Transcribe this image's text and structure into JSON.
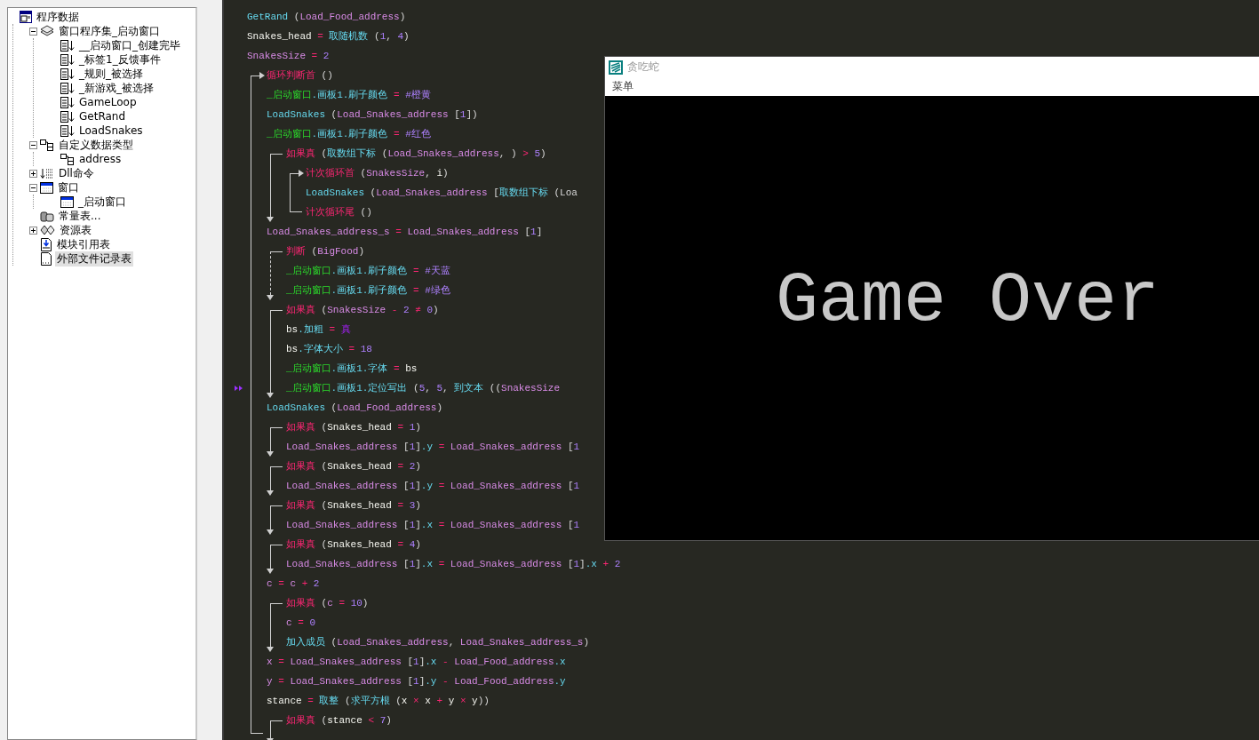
{
  "tree": [
    {
      "label": "程序数据",
      "kind": "root",
      "selected": false,
      "children": [
        {
          "label": "窗口程序集_启动窗口",
          "kind": "assembly",
          "selected": false,
          "expanded": true,
          "children": [
            {
              "label": "__启动窗口_创建完毕",
              "kind": "sub",
              "selected": false
            },
            {
              "label": "_标签1_反馈事件",
              "kind": "sub",
              "selected": false
            },
            {
              "label": "_规则_被选择",
              "kind": "sub",
              "selected": false
            },
            {
              "label": "_新游戏_被选择",
              "kind": "sub",
              "selected": false
            },
            {
              "label": "GameLoop",
              "kind": "sub",
              "selected": false
            },
            {
              "label": "GetRand",
              "kind": "sub",
              "selected": false
            },
            {
              "label": "LoadSnakes",
              "kind": "sub",
              "selected": false
            }
          ]
        },
        {
          "label": "自定义数据类型",
          "kind": "type",
          "selected": false,
          "expanded": true,
          "children": [
            {
              "label": "address",
              "kind": "type",
              "selected": false
            }
          ]
        },
        {
          "label": "Dll命令",
          "kind": "dll",
          "selected": false,
          "expanded": false
        },
        {
          "label": "窗口",
          "kind": "window",
          "selected": false,
          "expanded": true,
          "children": [
            {
              "label": "_启动窗口",
              "kind": "window",
              "selected": false
            }
          ]
        },
        {
          "label": "常量表...",
          "kind": "const",
          "selected": false
        },
        {
          "label": "资源表",
          "kind": "res",
          "selected": false,
          "expanded": false
        },
        {
          "label": "模块引用表",
          "kind": "module",
          "selected": false
        },
        {
          "label": "外部文件记录表",
          "kind": "file",
          "selected": true
        }
      ]
    }
  ],
  "code": [
    {
      "current": false,
      "tokens": [
        {
          "kind": "fn",
          "text": "GetRand"
        },
        {
          "kind": "p",
          "text": " ("
        },
        {
          "kind": "v",
          "text": "Load_Food_address"
        },
        {
          "kind": "p",
          "text": ")"
        }
      ]
    },
    {
      "current": false,
      "tokens": [
        {
          "kind": "id",
          "text": "Snakes_head"
        },
        {
          "kind": "op",
          "text": " = "
        },
        {
          "kind": "fn",
          "text": "取随机数"
        },
        {
          "kind": "p",
          "text": " ("
        },
        {
          "kind": "n",
          "text": "1"
        },
        {
          "kind": "p",
          "text": ", "
        },
        {
          "kind": "n",
          "text": "4"
        },
        {
          "kind": "p",
          "text": ")"
        }
      ]
    },
    {
      "current": false,
      "tokens": [
        {
          "kind": "v",
          "text": "SnakesSize"
        },
        {
          "kind": "op",
          "text": " = "
        },
        {
          "kind": "n",
          "text": "2"
        }
      ]
    },
    {
      "kind": "loop",
      "current": false,
      "tokens": [
        {
          "kind": "kw",
          "text": "循环判断首"
        },
        {
          "kind": "p",
          "text": " ()"
        }
      ],
      "children": [
        {
          "current": false,
          "tokens": [
            {
              "kind": "win",
              "text": "_启动窗口"
            },
            {
              "kind": "fn",
              "text": ".画板1.刷子颜色"
            },
            {
              "kind": "op",
              "text": " = "
            },
            {
              "kind": "c",
              "text": "#橙黄"
            }
          ]
        },
        {
          "current": false,
          "tokens": [
            {
              "kind": "fn",
              "text": "LoadSnakes"
            },
            {
              "kind": "p",
              "text": " ("
            },
            {
              "kind": "v",
              "text": "Load_Snakes_address"
            },
            {
              "kind": "p",
              "text": " ["
            },
            {
              "kind": "n",
              "text": "1"
            },
            {
              "kind": "p",
              "text": "])"
            }
          ]
        },
        {
          "current": false,
          "tokens": [
            {
              "kind": "win",
              "text": "_启动窗口"
            },
            {
              "kind": "fn",
              "text": ".画板1.刷子颜色"
            },
            {
              "kind": "op",
              "text": " = "
            },
            {
              "kind": "c",
              "text": "#红色"
            }
          ]
        },
        {
          "kind": "if",
          "current": false,
          "tokens": [
            {
              "kind": "kw",
              "text": "如果真"
            },
            {
              "kind": "p",
              "text": " ("
            },
            {
              "kind": "fn",
              "text": "取数组下标"
            },
            {
              "kind": "p",
              "text": " ("
            },
            {
              "kind": "v",
              "text": "Load_Snakes_address"
            },
            {
              "kind": "p",
              "text": ", )"
            },
            {
              "kind": "op",
              "text": " > "
            },
            {
              "kind": "n",
              "text": "5"
            },
            {
              "kind": "p",
              "text": ")"
            }
          ],
          "children": [
            {
              "kind": "count",
              "current": false,
              "tokens": [
                {
                  "kind": "kw",
                  "text": "计次循环首"
                },
                {
                  "kind": "p",
                  "text": " ("
                },
                {
                  "kind": "v",
                  "text": "SnakesSize"
                },
                {
                  "kind": "p",
                  "text": ", "
                },
                {
                  "kind": "id",
                  "text": "i"
                },
                {
                  "kind": "p",
                  "text": ")"
                }
              ],
              "children": [
                {
                  "current": false,
                  "tokens": [
                    {
                      "kind": "fn",
                      "text": "LoadSnakes"
                    },
                    {
                      "kind": "p",
                      "text": " ("
                    },
                    {
                      "kind": "v",
                      "text": "Load_Snakes_address"
                    },
                    {
                      "kind": "p",
                      "text": " ["
                    },
                    {
                      "kind": "fn",
                      "text": "取数组下标"
                    },
                    {
                      "kind": "p",
                      "text": " (Loa"
                    }
                  ]
                },
                {
                  "current": false,
                  "tokens": [
                    {
                      "kind": "kw",
                      "text": "计次循环尾"
                    },
                    {
                      "kind": "p",
                      "text": " ()"
                    }
                  ]
                }
              ]
            }
          ]
        },
        {
          "current": false,
          "tokens": [
            {
              "kind": "v",
              "text": "Load_Snakes_address_s"
            },
            {
              "kind": "op",
              "text": " = "
            },
            {
              "kind": "v",
              "text": "Load_Snakes_address"
            },
            {
              "kind": "p",
              "text": " ["
            },
            {
              "kind": "n",
              "text": "1"
            },
            {
              "kind": "p",
              "text": "]"
            }
          ]
        },
        {
          "kind": "switch",
          "current": false,
          "tokens": [
            {
              "kind": "kw",
              "text": "判断"
            },
            {
              "kind": "p",
              "text": " ("
            },
            {
              "kind": "v",
              "text": "BigFood"
            },
            {
              "kind": "p",
              "text": ")"
            }
          ],
          "children": [
            {
              "current": false,
              "tokens": [
                {
                  "kind": "win",
                  "text": "_启动窗口"
                },
                {
                  "kind": "fn",
                  "text": ".画板1.刷子颜色"
                },
                {
                  "kind": "op",
                  "text": " = "
                },
                {
                  "kind": "c",
                  "text": "#天蓝"
                }
              ]
            },
            {
              "current": false,
              "tokens": [
                {
                  "kind": "win",
                  "text": "_启动窗口"
                },
                {
                  "kind": "fn",
                  "text": ".画板1.刷子颜色"
                },
                {
                  "kind": "op",
                  "text": " = "
                },
                {
                  "kind": "c",
                  "text": "#绿色"
                }
              ]
            }
          ]
        },
        {
          "kind": "if",
          "current": false,
          "tokens": [
            {
              "kind": "kw",
              "text": "如果真"
            },
            {
              "kind": "p",
              "text": " ("
            },
            {
              "kind": "v",
              "text": "SnakesSize"
            },
            {
              "kind": "op",
              "text": " - "
            },
            {
              "kind": "n",
              "text": "2"
            },
            {
              "kind": "op",
              "text": " ≠ "
            },
            {
              "kind": "n",
              "text": "0"
            },
            {
              "kind": "p",
              "text": ")"
            }
          ],
          "children": [
            {
              "current": false,
              "tokens": [
                {
                  "kind": "id",
                  "text": "bs"
                },
                {
                  "kind": "fn",
                  "text": ".加粗"
                },
                {
                  "kind": "op",
                  "text": " = "
                },
                {
                  "kind": "t",
                  "text": "真"
                }
              ]
            },
            {
              "current": false,
              "tokens": [
                {
                  "kind": "id",
                  "text": "bs"
                },
                {
                  "kind": "fn",
                  "text": ".字体大小"
                },
                {
                  "kind": "op",
                  "text": " = "
                },
                {
                  "kind": "n",
                  "text": "18"
                }
              ]
            },
            {
              "current": false,
              "tokens": [
                {
                  "kind": "win",
                  "text": "_启动窗口"
                },
                {
                  "kind": "fn",
                  "text": ".画板1.字体"
                },
                {
                  "kind": "op",
                  "text": " = "
                },
                {
                  "kind": "id",
                  "text": "bs"
                }
              ]
            },
            {
              "current": true,
              "tokens": [
                {
                  "kind": "win",
                  "text": "_启动窗口"
                },
                {
                  "kind": "fn",
                  "text": ".画板1.定位写出"
                },
                {
                  "kind": "p",
                  "text": " ("
                },
                {
                  "kind": "n",
                  "text": "5"
                },
                {
                  "kind": "p",
                  "text": ", "
                },
                {
                  "kind": "n",
                  "text": "5"
                },
                {
                  "kind": "p",
                  "text": ", "
                },
                {
                  "kind": "fn",
                  "text": "到文本"
                },
                {
                  "kind": "p",
                  "text": " (("
                },
                {
                  "kind": "v",
                  "text": "SnakesSize"
                }
              ]
            }
          ]
        },
        {
          "current": false,
          "tokens": [
            {
              "kind": "fn",
              "text": "LoadSnakes"
            },
            {
              "kind": "p",
              "text": " ("
            },
            {
              "kind": "v",
              "text": "Load_Food_address"
            },
            {
              "kind": "p",
              "text": ")"
            }
          ]
        },
        {
          "kind": "if",
          "current": false,
          "tokens": [
            {
              "kind": "kw",
              "text": "如果真"
            },
            {
              "kind": "p",
              "text": " ("
            },
            {
              "kind": "id",
              "text": "Snakes_head"
            },
            {
              "kind": "op",
              "text": " = "
            },
            {
              "kind": "n",
              "text": "1"
            },
            {
              "kind": "p",
              "text": ")"
            }
          ],
          "children": [
            {
              "current": false,
              "tokens": [
                {
                  "kind": "v",
                  "text": "Load_Snakes_address"
                },
                {
                  "kind": "p",
                  "text": " ["
                },
                {
                  "kind": "n",
                  "text": "1"
                },
                {
                  "kind": "p",
                  "text": "]"
                },
                {
                  "kind": "fn",
                  "text": ".y"
                },
                {
                  "kind": "op",
                  "text": " = "
                },
                {
                  "kind": "v",
                  "text": "Load_Snakes_address"
                },
                {
                  "kind": "p",
                  "text": " ["
                },
                {
                  "kind": "n",
                  "text": "1"
                }
              ]
            }
          ]
        },
        {
          "kind": "if",
          "current": false,
          "tokens": [
            {
              "kind": "kw",
              "text": "如果真"
            },
            {
              "kind": "p",
              "text": " ("
            },
            {
              "kind": "id",
              "text": "Snakes_head"
            },
            {
              "kind": "op",
              "text": " = "
            },
            {
              "kind": "n",
              "text": "2"
            },
            {
              "kind": "p",
              "text": ")"
            }
          ],
          "children": [
            {
              "current": false,
              "tokens": [
                {
                  "kind": "v",
                  "text": "Load_Snakes_address"
                },
                {
                  "kind": "p",
                  "text": " ["
                },
                {
                  "kind": "n",
                  "text": "1"
                },
                {
                  "kind": "p",
                  "text": "]"
                },
                {
                  "kind": "fn",
                  "text": ".y"
                },
                {
                  "kind": "op",
                  "text": " = "
                },
                {
                  "kind": "v",
                  "text": "Load_Snakes_address"
                },
                {
                  "kind": "p",
                  "text": " ["
                },
                {
                  "kind": "n",
                  "text": "1"
                }
              ]
            }
          ]
        },
        {
          "kind": "if",
          "current": false,
          "tokens": [
            {
              "kind": "kw",
              "text": "如果真"
            },
            {
              "kind": "p",
              "text": " ("
            },
            {
              "kind": "id",
              "text": "Snakes_head"
            },
            {
              "kind": "op",
              "text": " = "
            },
            {
              "kind": "n",
              "text": "3"
            },
            {
              "kind": "p",
              "text": ")"
            }
          ],
          "children": [
            {
              "current": false,
              "tokens": [
                {
                  "kind": "v",
                  "text": "Load_Snakes_address"
                },
                {
                  "kind": "p",
                  "text": " ["
                },
                {
                  "kind": "n",
                  "text": "1"
                },
                {
                  "kind": "p",
                  "text": "]"
                },
                {
                  "kind": "fn",
                  "text": ".x"
                },
                {
                  "kind": "op",
                  "text": " = "
                },
                {
                  "kind": "v",
                  "text": "Load_Snakes_address"
                },
                {
                  "kind": "p",
                  "text": " ["
                },
                {
                  "kind": "n",
                  "text": "1"
                }
              ]
            }
          ]
        },
        {
          "kind": "if",
          "current": false,
          "tokens": [
            {
              "kind": "kw",
              "text": "如果真"
            },
            {
              "kind": "p",
              "text": " ("
            },
            {
              "kind": "id",
              "text": "Snakes_head"
            },
            {
              "kind": "op",
              "text": " = "
            },
            {
              "kind": "n",
              "text": "4"
            },
            {
              "kind": "p",
              "text": ")"
            }
          ],
          "children": [
            {
              "current": false,
              "tokens": [
                {
                  "kind": "v",
                  "text": "Load_Snakes_address"
                },
                {
                  "kind": "p",
                  "text": " ["
                },
                {
                  "kind": "n",
                  "text": "1"
                },
                {
                  "kind": "p",
                  "text": "]"
                },
                {
                  "kind": "fn",
                  "text": ".x"
                },
                {
                  "kind": "op",
                  "text": " = "
                },
                {
                  "kind": "v",
                  "text": "Load_Snakes_address"
                },
                {
                  "kind": "p",
                  "text": " ["
                },
                {
                  "kind": "n",
                  "text": "1"
                },
                {
                  "kind": "p",
                  "text": "]"
                },
                {
                  "kind": "fn",
                  "text": ".x"
                },
                {
                  "kind": "op",
                  "text": " + "
                },
                {
                  "kind": "n",
                  "text": "2"
                }
              ]
            }
          ]
        },
        {
          "current": false,
          "tokens": [
            {
              "kind": "v",
              "text": "c"
            },
            {
              "kind": "op",
              "text": " = "
            },
            {
              "kind": "v",
              "text": "c"
            },
            {
              "kind": "op",
              "text": " + "
            },
            {
              "kind": "n",
              "text": "2"
            }
          ]
        },
        {
          "kind": "if",
          "current": false,
          "tokens": [
            {
              "kind": "kw",
              "text": "如果真"
            },
            {
              "kind": "p",
              "text": " ("
            },
            {
              "kind": "v",
              "text": "c"
            },
            {
              "kind": "op",
              "text": " = "
            },
            {
              "kind": "n",
              "text": "10"
            },
            {
              "kind": "p",
              "text": ")"
            }
          ],
          "children": [
            {
              "current": false,
              "tokens": [
                {
                  "kind": "v",
                  "text": "c"
                },
                {
                  "kind": "op",
                  "text": " = "
                },
                {
                  "kind": "n",
                  "text": "0"
                }
              ]
            },
            {
              "current": false,
              "tokens": [
                {
                  "kind": "fn",
                  "text": "加入成员"
                },
                {
                  "kind": "p",
                  "text": " ("
                },
                {
                  "kind": "v",
                  "text": "Load_Snakes_address"
                },
                {
                  "kind": "p",
                  "text": ", "
                },
                {
                  "kind": "v",
                  "text": "Load_Snakes_address_s"
                },
                {
                  "kind": "p",
                  "text": ")"
                }
              ]
            }
          ]
        },
        {
          "current": false,
          "tokens": [
            {
              "kind": "v",
              "text": "x"
            },
            {
              "kind": "op",
              "text": " = "
            },
            {
              "kind": "v",
              "text": "Load_Snakes_address"
            },
            {
              "kind": "p",
              "text": " ["
            },
            {
              "kind": "n",
              "text": "1"
            },
            {
              "kind": "p",
              "text": "]"
            },
            {
              "kind": "fn",
              "text": ".x"
            },
            {
              "kind": "op",
              "text": " - "
            },
            {
              "kind": "v",
              "text": "Load_Food_address"
            },
            {
              "kind": "fn",
              "text": ".x"
            }
          ]
        },
        {
          "current": false,
          "tokens": [
            {
              "kind": "v",
              "text": "y"
            },
            {
              "kind": "op",
              "text": " = "
            },
            {
              "kind": "v",
              "text": "Load_Snakes_address"
            },
            {
              "kind": "p",
              "text": " ["
            },
            {
              "kind": "n",
              "text": "1"
            },
            {
              "kind": "p",
              "text": "]"
            },
            {
              "kind": "fn",
              "text": ".y"
            },
            {
              "kind": "op",
              "text": " - "
            },
            {
              "kind": "v",
              "text": "Load_Food_address"
            },
            {
              "kind": "fn",
              "text": ".y"
            }
          ]
        },
        {
          "current": false,
          "tokens": [
            {
              "kind": "id",
              "text": "stance"
            },
            {
              "kind": "op",
              "text": " = "
            },
            {
              "kind": "fn",
              "text": "取整"
            },
            {
              "kind": "p",
              "text": " ("
            },
            {
              "kind": "fn",
              "text": "求平方根"
            },
            {
              "kind": "p",
              "text": " ("
            },
            {
              "kind": "id",
              "text": "x"
            },
            {
              "kind": "op",
              "text": " × "
            },
            {
              "kind": "id",
              "text": "x"
            },
            {
              "kind": "op",
              "text": " + "
            },
            {
              "kind": "id",
              "text": "y"
            },
            {
              "kind": "op",
              "text": " × "
            },
            {
              "kind": "id",
              "text": "y"
            },
            {
              "kind": "p",
              "text": "))"
            }
          ]
        },
        {
          "kind": "if",
          "current": false,
          "tokens": [
            {
              "kind": "kw",
              "text": "如果真"
            },
            {
              "kind": "p",
              "text": " ("
            },
            {
              "kind": "id",
              "text": "stance"
            },
            {
              "kind": "op",
              "text": " < "
            },
            {
              "kind": "n",
              "text": "7"
            },
            {
              "kind": "p",
              "text": ")"
            }
          ]
        }
      ]
    }
  ],
  "game_window": {
    "title": "贪吃蛇",
    "active": false,
    "menu": [
      "菜单"
    ],
    "canvas_text": "Game Over"
  }
}
